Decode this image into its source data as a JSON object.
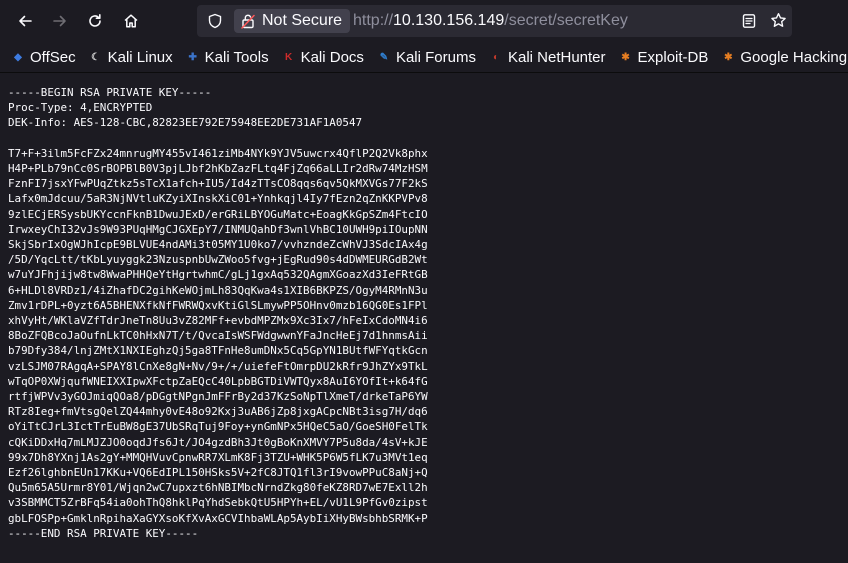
{
  "browser": {
    "security_label": "Not Secure",
    "url_scheme": "http://",
    "url_host": "10.130.156.149",
    "url_path": "/secret/secretKey",
    "icons": {
      "back": "back-arrow-icon",
      "forward": "forward-arrow-icon",
      "reload": "reload-icon",
      "home": "home-icon",
      "shield": "shield-icon",
      "lock": "lock-broken-icon",
      "reader": "reader-view-icon",
      "bookmark": "star-icon"
    }
  },
  "bookmarks": [
    {
      "label": "OffSec",
      "icon": "offsec-icon",
      "color": "#3d7be0"
    },
    {
      "label": "Kali Linux",
      "icon": "kali-dragon-icon",
      "color": "#d0d0d0"
    },
    {
      "label": "Kali Tools",
      "icon": "kali-tools-icon",
      "color": "#3b73c9"
    },
    {
      "label": "Kali Docs",
      "icon": "kali-docs-icon",
      "color": "#cc2b2b"
    },
    {
      "label": "Kali Forums",
      "icon": "kali-forums-icon",
      "color": "#2f7fd1"
    },
    {
      "label": "Kali NetHunter",
      "icon": "nethunter-icon",
      "color": "#c0392b"
    },
    {
      "label": "Exploit-DB",
      "icon": "exploit-db-icon",
      "color": "#e67e22"
    },
    {
      "label": "Google Hacking D",
      "icon": "ghdb-icon",
      "color": "#e67e22"
    }
  ],
  "document": {
    "lines": [
      "-----BEGIN RSA PRIVATE KEY-----",
      "Proc-Type: 4,ENCRYPTED",
      "DEK-Info: AES-128-CBC,82823EE792E75948EE2DE731AF1A0547",
      "",
      "T7+F+3ilm5FcFZx24mnrugMY455vI461ziMb4NYk9YJV5uwcrx4QflP2Q2Vk8phx",
      "H4P+PLb79nCc0SrBOPBlB0V3pjLJbf2hKbZazFLtq4FjZq66aLLIr2dRw74MzHSM",
      "FznFI7jsxYFwPUqZtkz5sTcX1afch+IU5/Id4zTTsCO8qqs6qv5QkMXVGs77F2kS",
      "Lafx0mJdcuu/5aR3NjNVtluKZyiXInskXiC01+Ynhkqjl4Iy7fEzn2qZnKKPVPv8",
      "9zlECjERSysbUKYccnFknB1DwuJExD/erGRiLBYOGuMatc+EoagKkGpSZm4FtcIO",
      "IrwxeyChI32vJs9W93PUqHMgCJGXEpY7/INMUQahDf3wnlVhBC10UWH9piIOupNN",
      "SkjSbrIxOgWJhIcpE9BLVUE4ndAMi3t05MY1U0ko7/vvhzndeZcWhVJ3SdcIAx4g",
      "/5D/YqcLtt/tKbLyuyggk23NzuspnbUwZWoo5fvg+jEgRud90s4dDWMEURGdB2Wt",
      "w7uYJFhjijw8tw8WwaPHHQeYtHgrtwhmC/gLj1gxAq532QAgmXGoazXd3IeFRtGB",
      "6+HLDl8VRDz1/4iZhafDC2gihKeWOjmLh83QqKwa4s1XIB6BKPZS/OgyM4RMnN3u",
      "Zmv1rDPL+0yzt6A5BHENXfkNfFWRWQxvKtiGlSLmywPP5OHnv0mzb16QG0Es1FPl",
      "xhVyHt/WKlaVZfTdrJneTn8Uu3vZ82MFf+evbdMPZMx9Xc3Ix7/hFeIxCdoMN4i6",
      "8BoZFQBcoJaOufnLkTC0hHxN7T/t/QvcaIsWSFWdgwwnYFaJncHeEj7d1hnmsAii",
      "b79Dfy384/lnjZMtX1NXIEghzQj5ga8TFnHe8umDNx5Cq5GpYN1BUtfWFYqtkGcn",
      "vzLSJM07RAgqA+SPAY8lCnXe8gN+Nv/9+/+/uiefeFtOmrpDU2kRfr9JhZYx9TkL",
      "wTqOP0XWjqufWNEIXXIpwXFctpZaEQcC40LpbBGTDiVWTQyx8AuI6YOfIt+k64fG",
      "rtfjWPVv3yGOJmiqQOa8/pDGgtNPgnJmFFrBy2d37KzSoNpTlXmeT/drkeTaP6YW",
      "RTz8Ieg+fmVtsgQelZQ44mhy0vE48o92Kxj3uAB6jZp8jxgACpcNBt3isg7H/dq6",
      "oYiTtCJrL3IctTrEuBW8gE37UbSRqTuj9Foy+ynGmNPx5HQeC5aO/GoeSH0FelTk",
      "cQKiDDxHq7mLMJZJO0oqdJfs6Jt/JO4gzdBh3Jt0gBoKnXMVY7P5u8da/4sV+kJE",
      "99x7Dh8YXnj1As2gY+MMQHVuvCpnwRR7XLmK8Fj3TZU+WHK5P6W5fLK7u3MVt1eq",
      "Ezf26lghbnEUn17KKu+VQ6EdIPL150HSks5V+2fC8JTQ1fl3rI9vowPPuC8aNj+Q",
      "Qu5m65A5Urmr8Y01/Wjqn2wC7upxzt6hNBIMbcNrndZkg80feKZ8RD7wE7Exll2h",
      "v3SBMMCT5ZrBFq54ia0ohThQ8hklPqYhdSebkQtU5HPYh+EL/vU1L9PfGv0zipst",
      "gbLFOSPp+GmklnRpihaXaGYXsoKfXvAxGCVIhbaWLAp5AybIiXHyBWsbhbSRMK+P",
      "-----END RSA PRIVATE KEY-----"
    ]
  }
}
